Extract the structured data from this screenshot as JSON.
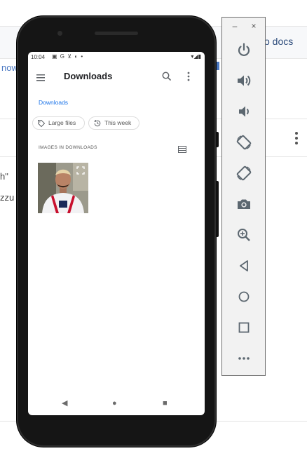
{
  "background_page": {
    "docs_link": "o docs",
    "now_link": "now",
    "partial_text_1": "h\"",
    "partial_text_2": "zzu"
  },
  "emulator_toolbar": {
    "minimize": "–",
    "close": "×",
    "buttons": [
      "power-icon",
      "volume-up-icon",
      "volume-down-icon",
      "rotate-left-icon",
      "rotate-right-icon",
      "camera-icon",
      "zoom-icon",
      "back-icon",
      "home-icon",
      "overview-icon",
      "more-icon"
    ]
  },
  "phone": {
    "status_bar": {
      "time": "10:04",
      "left_icons": "▣ G ⊻ ◐ •",
      "right_icons": "▾◢▮"
    },
    "app_bar": {
      "title": "Downloads"
    },
    "breadcrumb": "Downloads",
    "chips": {
      "large_files": "Large files",
      "this_week": "This week"
    },
    "section_header": "IMAGES IN DOWNLOADS",
    "nav": [
      "◀",
      "●",
      "■"
    ]
  },
  "colors": {
    "accent": "#1a73e8",
    "docs_link": "#2d4c7c",
    "now_link": "#4a78c2",
    "phone_body": "#151515",
    "toolbar_icon": "#5c6770"
  }
}
